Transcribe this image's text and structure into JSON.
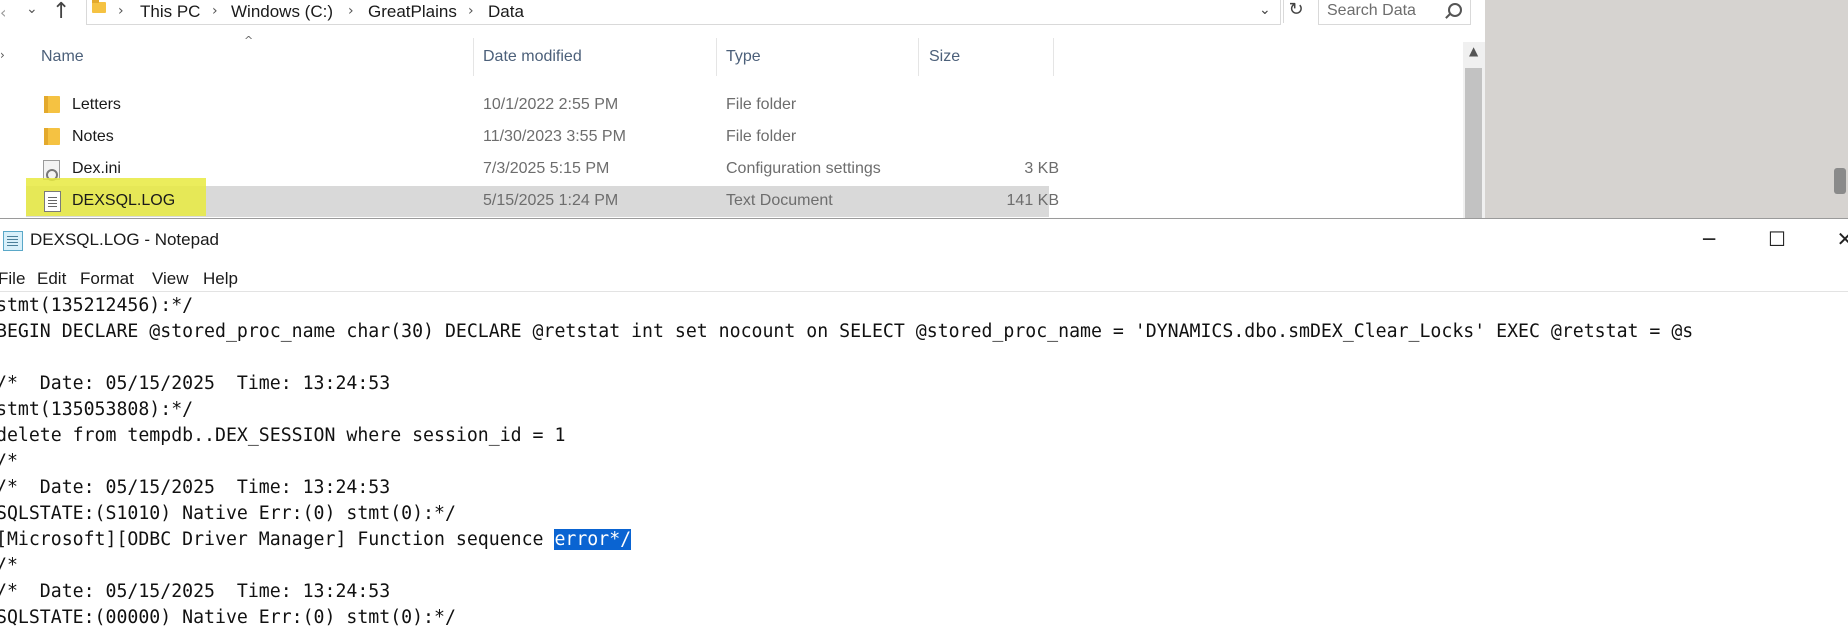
{
  "explorer": {
    "breadcrumb": [
      "This PC",
      "Windows (C:)",
      "GreatPlains",
      "Data"
    ],
    "search_placeholder": "Search Data",
    "columns": {
      "name": "Name",
      "date": "Date modified",
      "type": "Type",
      "size": "Size"
    },
    "files": [
      {
        "name": "Letters",
        "date": "10/1/2022 2:55 PM",
        "type": "File folder",
        "size": "",
        "icon": "folder-icon"
      },
      {
        "name": "Notes",
        "date": "11/30/2023 3:55 PM",
        "type": "File folder",
        "size": "",
        "icon": "folder-icon"
      },
      {
        "name": "Dex.ini",
        "date": "7/3/2025 5:15 PM",
        "type": "Configuration settings",
        "size": "3 KB",
        "icon": "config-file-icon"
      },
      {
        "name": "DEXSQL.LOG",
        "date": "5/15/2025 1:24 PM",
        "type": "Text Document",
        "size": "141 KB",
        "icon": "text-file-icon"
      }
    ],
    "highlight_color": "#e8ea40"
  },
  "notepad": {
    "title": "DEXSQL.LOG - Notepad",
    "menu": [
      "File",
      "Edit",
      "Format",
      "View",
      "Help"
    ],
    "lines": [
      "stmt(135212456):*/",
      "BEGIN DECLARE @stored_proc_name char(30) DECLARE @retstat int set nocount on SELECT @stored_proc_name = 'DYNAMICS.dbo.smDEX_Clear_Locks' EXEC @retstat = @s",
      "",
      "/*  Date: 05/15/2025  Time: 13:24:53",
      "stmt(135053808):*/",
      "delete from tempdb..DEX_SESSION where session_id = 1",
      "/*",
      "/*  Date: 05/15/2025  Time: 13:24:53",
      "SQLSTATE:(S1010) Native Err:(0) stmt(0):*/",
      "",
      "/*",
      "/*  Date: 05/15/2025  Time: 13:24:53",
      "SQLSTATE:(00000) Native Err:(0) stmt(0):*/"
    ],
    "selected_line_prefix": "[Microsoft][ODBC Driver Manager] Function sequence ",
    "selected_text": "error*/",
    "selection_color": "#0a64d2"
  }
}
